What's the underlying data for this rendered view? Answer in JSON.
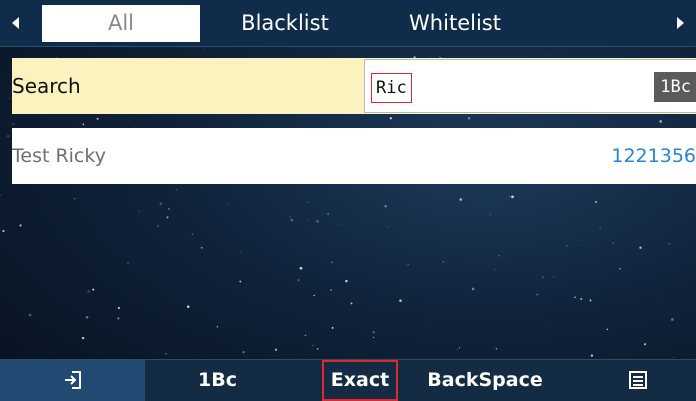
{
  "tabs": [
    {
      "label": "All",
      "active": true
    },
    {
      "label": "Blacklist",
      "active": false
    },
    {
      "label": "Whitelist",
      "active": false
    }
  ],
  "search": {
    "label": "Search",
    "value": "Ric",
    "input_mode": "1Bc"
  },
  "results": [
    {
      "name": "Test Ricky",
      "number": "1221356"
    }
  ],
  "softkeys": {
    "exit_icon": "exit-icon",
    "input_mode": "1Bc",
    "exact": "Exact",
    "backspace": "BackSpace",
    "menu_icon": "menu-icon"
  },
  "colors": {
    "accent_yellow": "#fbf2bf",
    "number_blue": "#2b84d6",
    "selection_red": "#e0282f"
  }
}
